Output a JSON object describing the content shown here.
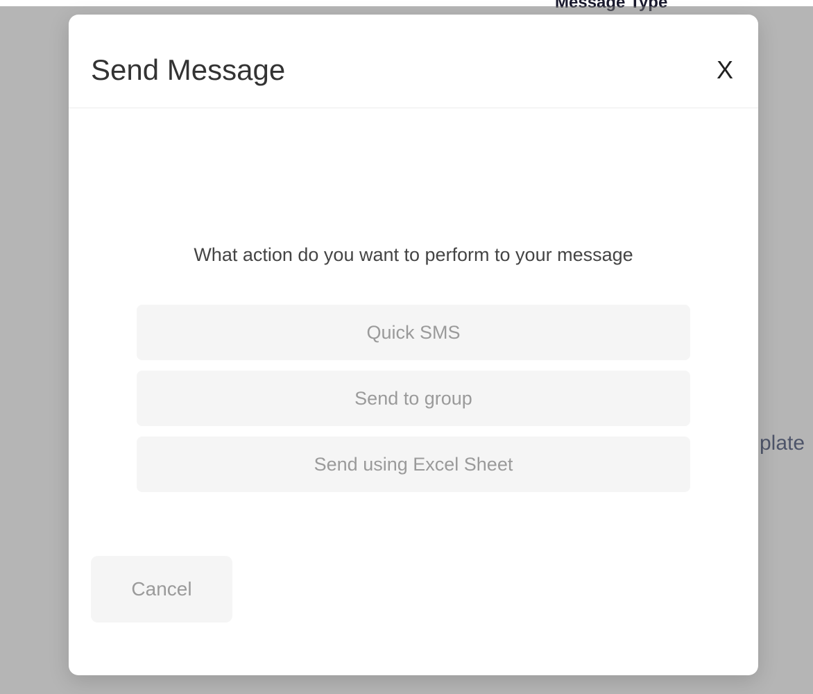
{
  "background": {
    "header_label": "Message Type",
    "right_text_fragment": "plate"
  },
  "modal": {
    "title": "Send Message",
    "close_label": "X",
    "prompt": "What action do you want to perform to your message",
    "options": [
      "Quick SMS",
      "Send to group",
      "Send using Excel Sheet"
    ],
    "cancel_label": "Cancel"
  }
}
